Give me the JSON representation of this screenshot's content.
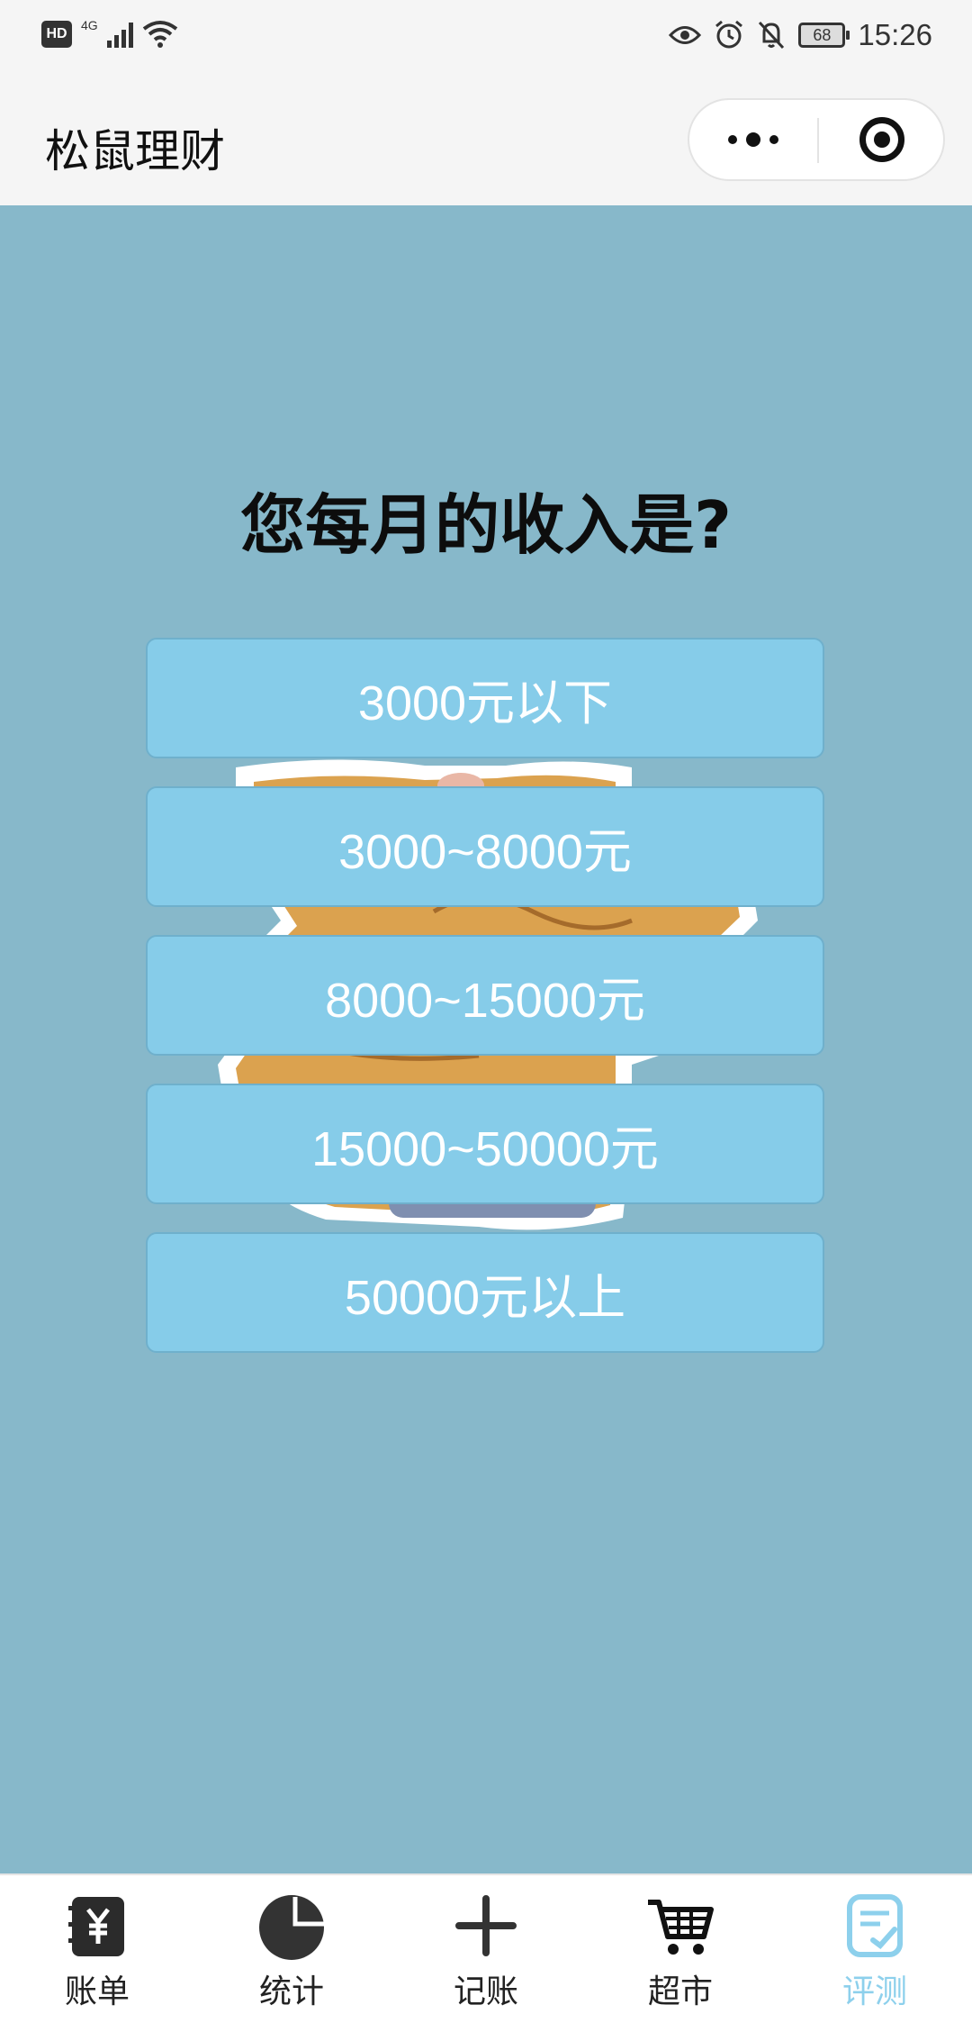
{
  "status_bar": {
    "hd": "HD",
    "network": "4G",
    "battery": "68",
    "time": "15:26",
    "icons": [
      "hd-icon",
      "signal-icon",
      "wifi-icon",
      "eye-icon",
      "alarm-icon",
      "mute-icon",
      "battery-icon"
    ]
  },
  "nav": {
    "title": "松鼠理财"
  },
  "main": {
    "question": "您每月的收入是?",
    "options": [
      "3000元以下",
      "3000~8000元",
      "8000~15000元",
      "15000~50000元",
      "50000元以上"
    ]
  },
  "tabbar": {
    "items": [
      {
        "label": "账单",
        "icon": "bill-icon"
      },
      {
        "label": "统计",
        "icon": "pie-chart-icon"
      },
      {
        "label": "记账",
        "icon": "plus-icon"
      },
      {
        "label": "超市",
        "icon": "cart-icon"
      },
      {
        "label": "评测",
        "icon": "assessment-icon",
        "active": true
      }
    ]
  },
  "colors": {
    "background": "#87b8ca",
    "option": "#86cce9",
    "active_tab": "#8dd0ec"
  }
}
